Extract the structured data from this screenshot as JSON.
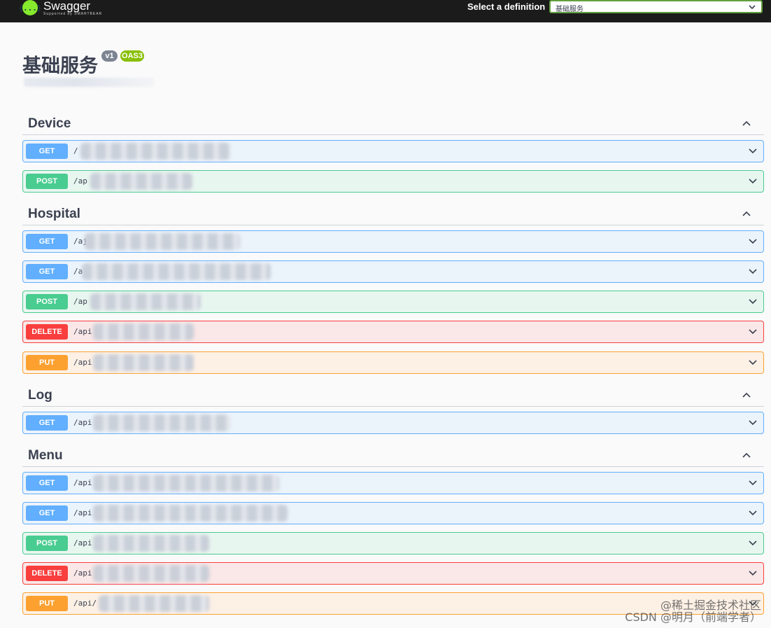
{
  "topbar": {
    "logo_icon": "{...}",
    "logo_name": "Swagger",
    "logo_sub": "Supported by SMARTBEAR",
    "definition_label": "Select a definition",
    "definition_value": "基础服务"
  },
  "info": {
    "title": "基础服务",
    "version": "v1",
    "oas": "OAS3"
  },
  "tags": [
    {
      "name": "Device",
      "operations": [
        {
          "method": "GET",
          "path": "/"
        },
        {
          "method": "POST",
          "path": "/ap"
        }
      ]
    },
    {
      "name": "Hospital",
      "operations": [
        {
          "method": "GET",
          "path": "/aj"
        },
        {
          "method": "GET",
          "path": "/a"
        },
        {
          "method": "POST",
          "path": "/ap"
        },
        {
          "method": "DELETE",
          "path": "/api"
        },
        {
          "method": "PUT",
          "path": "/api"
        }
      ]
    },
    {
      "name": "Log",
      "operations": [
        {
          "method": "GET",
          "path": "/api"
        }
      ]
    },
    {
      "name": "Menu",
      "operations": [
        {
          "method": "GET",
          "path": "/api"
        },
        {
          "method": "GET",
          "path": "/api"
        },
        {
          "method": "POST",
          "path": "/api"
        },
        {
          "method": "DELETE",
          "path": "/api"
        },
        {
          "method": "PUT",
          "path": "/api/"
        }
      ]
    }
  ],
  "watermark": {
    "line1": "@稀土掘金技术社区",
    "line2": "CSDN @明月（前端学者）"
  },
  "colors": {
    "get": "#61affe",
    "post": "#49cc90",
    "delete": "#f93e3e",
    "put": "#fca130",
    "topbar": "#1b1b1b",
    "logo": "#85ea2d"
  }
}
